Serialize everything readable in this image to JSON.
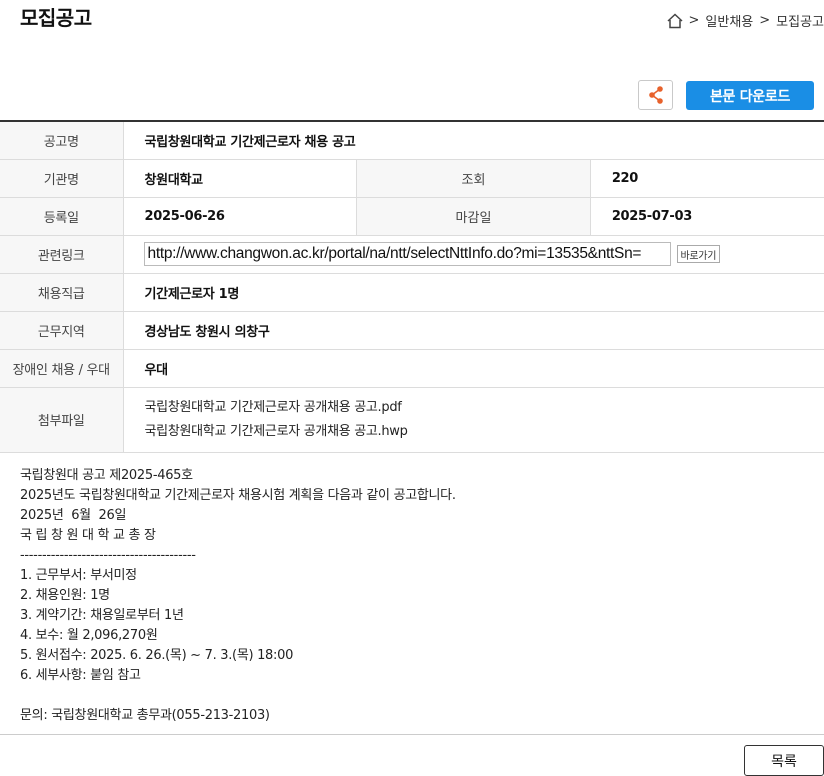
{
  "header": {
    "title": "모집공고",
    "breadcrumb": {
      "sep": ">",
      "items": [
        "일반채용",
        "모집공고"
      ]
    }
  },
  "actions": {
    "share_icon": "share-icon",
    "download_label": "본문 다운로드"
  },
  "info": {
    "title_label": "공고명",
    "title_value": "국립창원대학교 기간제근로자 채용 공고",
    "org_label": "기관명",
    "org_value": "창원대학교",
    "views_label": "조회",
    "views_value": "220",
    "reg_label": "등록일",
    "reg_value": "2025-06-26",
    "deadline_label": "마감일",
    "deadline_value": "2025-07-03",
    "link_label": "관련링크",
    "link_value": "http://www.changwon.ac.kr/portal/na/ntt/selectNttInfo.do?mi=13535&nttSn=",
    "go_label": "바로가기",
    "job_label": "채용직급",
    "job_value": "기간제근로자 1명",
    "region_label": "근무지역",
    "region_value": "경상남도 창원시 의창구",
    "disabled_label": "장애인 채용 / 우대",
    "disabled_value": "우대",
    "files_label": "첨부파일",
    "files": [
      "국립창원대학교 기간제근로자 공개채용 공고.pdf",
      "국립창원대학교 기간제근로자 공개채용 공고.hwp"
    ]
  },
  "body_lines": [
    "국립창원대 공고 제2025-465호",
    "2025년도 국립창원대학교 기간제근로자 채용시험 계획을 다음과 같이 공고합니다.",
    "2025년  6월  26일",
    "국 립 창 원 대 학 교 총 장",
    "----------------------------------------",
    "1. 근무부서: 부서미정",
    "2. 채용인원: 1명",
    "3. 계약기간: 채용일로부터 1년",
    "4. 보수: 월 2,096,270원",
    "5. 원서접수: 2025. 6. 26.(목) ~ 7. 3.(목) 18:00",
    "6. 세부사항: 붙임 참고",
    "",
    "문의: 국립창원대학교 총무과(055-213-2103)"
  ],
  "footer": {
    "list_label": "목록"
  }
}
